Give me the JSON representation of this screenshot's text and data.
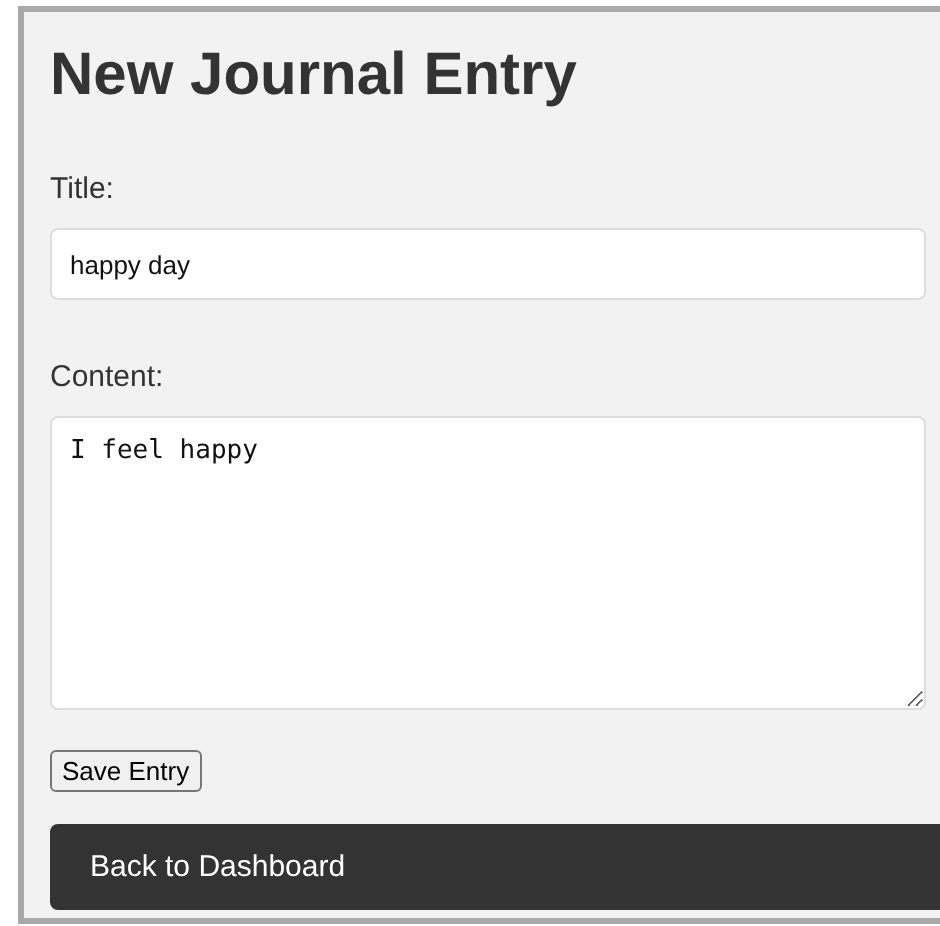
{
  "heading": "New Journal Entry",
  "fields": [
    {
      "kind": "input",
      "label": "Title:",
      "value": "happy day"
    },
    {
      "kind": "textarea",
      "label": "Content:",
      "value": "I feel happy"
    }
  ],
  "save_button": "Save Entry",
  "back_link": "Back to Dashboard"
}
